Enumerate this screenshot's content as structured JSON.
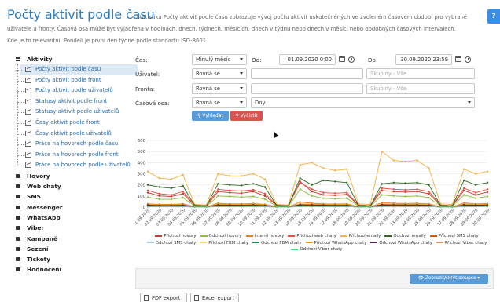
{
  "page": {
    "title": "Počty aktivit podle času",
    "description_line1": "» Statistika Počty aktivit podle času zobrazuje vývoj počtu aktivit uskutečněných ve zvoleném časovém období pro vybrané",
    "description_line2": "uživatele a fronty. Časová osa může být vyjádřena v hodinách, dnech, týdnech, měsících, dnech v týdnu nebo dnech v měsíci nebo obdobných časových intervalech.",
    "description_line3": "Kde je to relevantní, Pondělí je první den týdne podle standartu ISO-8601.",
    "help_label": "?"
  },
  "sidebar": {
    "open_category": "Aktivity",
    "items": [
      "Počty aktivit podle času",
      "Počty aktivit podle front",
      "Počty aktivit podle uživatelů",
      "Statusy aktivit podle front",
      "Statusy aktivit podle uživatelů",
      "Časy aktivit podle front",
      "Časy aktivit podle uživatelů",
      "Práce na hovorech podle času",
      "Práce na hovorech podle front",
      "Práce na hovorech podle uživatelů"
    ],
    "categories": [
      "Hovory",
      "Web chaty",
      "SMS",
      "Messenger",
      "WhatsApp",
      "Viber",
      "Kampaně",
      "Sezení",
      "Tickety",
      "Hodnocení"
    ]
  },
  "filters": {
    "cas_label": "Čas:",
    "cas_value": "Minulý měsíc",
    "od_label": "Od:",
    "od_value": "01.09.2020 0:00",
    "do_label": "Do:",
    "do_value": "30.09.2020 23:59",
    "uzivatel_label": "Uživatel:",
    "uzivatel_mode": "Rovná se",
    "uzivatel_groups_placeholder": "Skupiny - Vše",
    "fronta_label": "Fronta:",
    "fronta_mode": "Rovná se",
    "fronta_groups_placeholder": "Skupiny - Vše",
    "osa_label": "Časová osa:",
    "osa_mode": "Rovná se",
    "osa_value": "Dny",
    "search_label": "Vyhledat",
    "clear_label": "Vyčistit"
  },
  "actions": {
    "toggle_columns": "Zobrazit/skrýt sloupce",
    "pdf_export": "PDF export",
    "excel_export": "Excel export"
  },
  "chart_data": {
    "type": "line",
    "ylim": [
      0,
      600
    ],
    "yticks": [
      0,
      100,
      200,
      300,
      400,
      500,
      600
    ],
    "grid": true,
    "legend_position": "bottom",
    "x": [
      "01.09.2020",
      "02.09.2020",
      "03.09.2020",
      "04.09.2020",
      "05.09.2020",
      "06.09.2020",
      "07.09.2020",
      "08.09.2020",
      "09.09.2020",
      "10.09.2020",
      "11.09.2020",
      "12.09.2020",
      "13.09.2020",
      "14.09.2020",
      "15.09.2020",
      "16.09.2020",
      "17.09.2020",
      "18.09.2020",
      "19.09.2020",
      "20.09.2020",
      "21.09.2020",
      "22.09.2020",
      "23.09.2020",
      "24.09.2020",
      "25.09.2020",
      "26.09.2020",
      "27.09.2020",
      "28.09.2020",
      "29.09.2020",
      "30.09.2020"
    ],
    "series": [
      {
        "name": "Příchozí hovory",
        "color": "#c0392b",
        "values": [
          130,
          100,
          95,
          120,
          15,
          10,
          140,
          130,
          125,
          140,
          100,
          15,
          10,
          230,
          140,
          110,
          105,
          115,
          15,
          10,
          150,
          140,
          135,
          140,
          120,
          15,
          10,
          150,
          110,
          135
        ]
      },
      {
        "name": "Odchozí hovory",
        "color": "#8bbf3f",
        "values": [
          90,
          70,
          70,
          85,
          10,
          5,
          100,
          95,
          90,
          95,
          70,
          10,
          5,
          160,
          100,
          80,
          75,
          80,
          10,
          5,
          110,
          100,
          95,
          100,
          85,
          10,
          5,
          110,
          80,
          95
        ]
      },
      {
        "name": "Interní hovory",
        "color": "#e67e22",
        "values": [
          30,
          25,
          25,
          30,
          5,
          3,
          35,
          30,
          30,
          32,
          25,
          5,
          3,
          45,
          35,
          30,
          28,
          30,
          5,
          3,
          40,
          35,
          32,
          35,
          30,
          5,
          3,
          38,
          30,
          32
        ]
      },
      {
        "name": "Příchozí web chaty",
        "color": "#e74c3c",
        "values": [
          150,
          120,
          110,
          140,
          20,
          15,
          160,
          150,
          145,
          155,
          120,
          20,
          15,
          220,
          160,
          130,
          125,
          130,
          20,
          15,
          170,
          160,
          155,
          160,
          140,
          20,
          15,
          170,
          130,
          160
        ]
      },
      {
        "name": "Příchozí emaily",
        "color": "#f5b041",
        "values": [
          320,
          260,
          250,
          290,
          25,
          20,
          300,
          280,
          280,
          300,
          250,
          25,
          20,
          380,
          400,
          350,
          330,
          340,
          30,
          25,
          500,
          420,
          410,
          420,
          350,
          30,
          25,
          340,
          300,
          320
        ]
      },
      {
        "name": "Odchozí emaily",
        "color": "#2e6b1f",
        "values": [
          200,
          180,
          170,
          190,
          15,
          10,
          210,
          200,
          195,
          210,
          180,
          15,
          10,
          260,
          200,
          240,
          230,
          220,
          15,
          10,
          210,
          220,
          215,
          220,
          200,
          15,
          10,
          240,
          200,
          220
        ]
      },
      {
        "name": "Příchozí SMS chaty",
        "color": "#d35400",
        "values": [
          12,
          10,
          10,
          12,
          2,
          1,
          14,
          12,
          12,
          13,
          10,
          2,
          1,
          16,
          14,
          12,
          11,
          12,
          2,
          1,
          15,
          14,
          13,
          14,
          12,
          2,
          1,
          14,
          12,
          13
        ]
      },
      {
        "name": "Odchozí SMS chaty",
        "color": "#a9cce3",
        "values": [
          8,
          6,
          6,
          8,
          1,
          1,
          9,
          8,
          8,
          9,
          6,
          1,
          1,
          10,
          9,
          8,
          7,
          8,
          1,
          1,
          10,
          9,
          8,
          9,
          8,
          1,
          1,
          9,
          8,
          9
        ]
      },
      {
        "name": "Příchozí FBM chaty",
        "color": "#f7dc6f",
        "values": [
          20,
          18,
          16,
          20,
          3,
          2,
          22,
          20,
          19,
          21,
          18,
          3,
          2,
          25,
          22,
          20,
          19,
          20,
          3,
          2,
          24,
          22,
          21,
          22,
          20,
          3,
          2,
          23,
          20,
          22
        ]
      },
      {
        "name": "Odchozí FBM chaty",
        "color": "#1e8449",
        "values": [
          15,
          12,
          11,
          14,
          2,
          1,
          16,
          15,
          14,
          15,
          12,
          2,
          1,
          18,
          16,
          14,
          13,
          14,
          2,
          1,
          17,
          16,
          15,
          16,
          14,
          2,
          1,
          16,
          14,
          15
        ]
      },
      {
        "name": "Příchozí WhatsApp chaty",
        "color": "#f39c12",
        "values": [
          25,
          22,
          20,
          24,
          4,
          3,
          27,
          25,
          24,
          26,
          22,
          4,
          3,
          30,
          27,
          25,
          23,
          24,
          4,
          3,
          29,
          27,
          26,
          27,
          24,
          4,
          3,
          28,
          25,
          26
        ]
      },
      {
        "name": "Odchozí WhatsApp chaty",
        "color": "#4a235a",
        "values": [
          18,
          15,
          14,
          17,
          3,
          2,
          20,
          18,
          17,
          19,
          15,
          3,
          2,
          22,
          20,
          18,
          16,
          17,
          3,
          2,
          21,
          20,
          19,
          20,
          17,
          3,
          2,
          20,
          18,
          19
        ]
      },
      {
        "name": "Příchozí Viber chaty",
        "color": "#e59866",
        "values": [
          6,
          5,
          5,
          6,
          1,
          1,
          7,
          6,
          6,
          7,
          5,
          1,
          1,
          8,
          7,
          6,
          5,
          6,
          1,
          1,
          7,
          7,
          6,
          7,
          6,
          1,
          1,
          7,
          6,
          7
        ]
      },
      {
        "name": "Odchozí Viber chaty",
        "color": "#58d68d",
        "values": [
          4,
          3,
          3,
          4,
          1,
          0,
          5,
          4,
          4,
          5,
          3,
          1,
          0,
          6,
          5,
          4,
          3,
          4,
          1,
          0,
          5,
          5,
          4,
          5,
          4,
          1,
          0,
          5,
          4,
          5
        ]
      }
    ]
  }
}
